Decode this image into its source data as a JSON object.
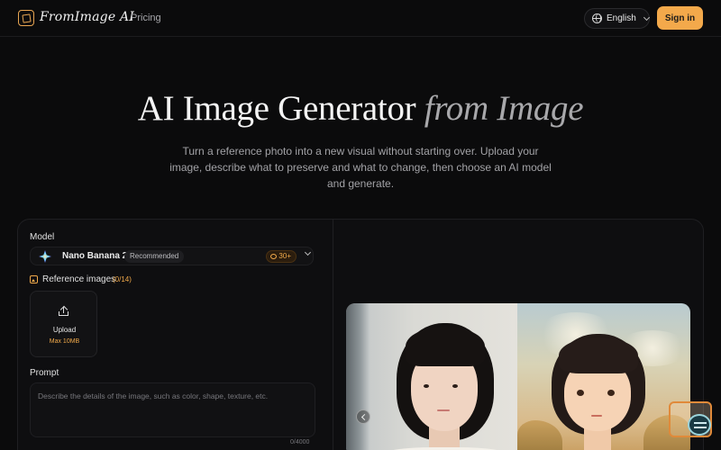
{
  "header": {
    "logo_text": "FromImage AI",
    "nav": {
      "pricing": "Pricing"
    },
    "language": "English",
    "signin": "Sign in"
  },
  "hero": {
    "title_main": "AI Image Generator",
    "title_accent": "from Image",
    "subtitle": "Turn a reference photo into a new visual without starting over. Upload your image, describe what to preserve and what to change, then choose an AI model and generate."
  },
  "form": {
    "model_label": "Model",
    "model": {
      "name": "Nano Banana 2",
      "badge": "Recommended",
      "credits": "30+"
    },
    "reference": {
      "label": "Reference images",
      "count": "(0/14)",
      "upload_label": "Upload",
      "upload_max": "Max 10MB"
    },
    "prompt": {
      "label": "Prompt",
      "placeholder": "Describe the details of the image, such as color, shape, texture, etc.",
      "value": "",
      "char_count": "0/4000"
    }
  },
  "colors": {
    "accent": "#f3a94b",
    "background": "#0b0b0c",
    "card": "#0e0e10"
  },
  "icons": [
    "logo-icon",
    "globe-icon",
    "chevron-down-icon",
    "sparkle-model-icon",
    "coin-icon",
    "image-icon",
    "upload-icon",
    "compare-arrow-icon",
    "chat-support-icon"
  ]
}
